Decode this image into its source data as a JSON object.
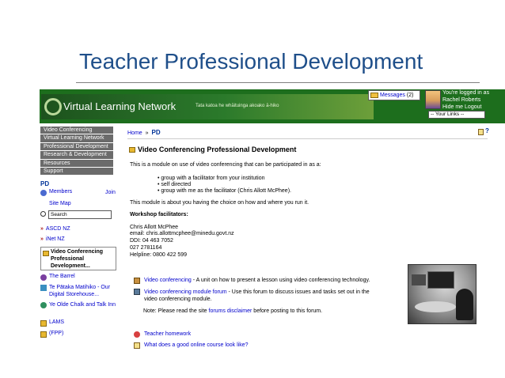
{
  "slide": {
    "title": "Teacher Professional Development"
  },
  "banner": {
    "site_name": "Virtual Learning Network",
    "tagline": "Tata katoa he whāituinga akoako ā-hiko"
  },
  "header": {
    "messages_label": "Messages",
    "messages_count": "(2)",
    "logged_in_text": "You're logged in as",
    "user_name": "Rachel Roberts",
    "hide_me": "Hide me",
    "logout": "Logout",
    "your_links": "-- Your Links --"
  },
  "nav": {
    "items": [
      "Video Conferencing",
      "Virtual Learning Network",
      "Professional Development",
      "Research & Development",
      "Resources",
      "Support"
    ]
  },
  "sidebar": {
    "heading": "PD",
    "members": "Members",
    "join": "Join",
    "site_map": "Site Map",
    "search_value": "Search",
    "links": [
      "ASCD NZ",
      "iNet NZ"
    ],
    "active_item": "Video Conferencing Professional Development...",
    "more_links": [
      "The Barrel",
      "Te Pātaka Matihiko - Our Digital Storehouse...",
      "Ye Olde Chalk and Talk Inn",
      "LAMS",
      "(FPP)"
    ]
  },
  "breadcrumb": {
    "home": "Home",
    "sep": "»",
    "current": "PD"
  },
  "module": {
    "title": "Video Conferencing Professional Development",
    "intro": "This is a module on use of video conferencing that can be participated in as a:",
    "bullets": [
      "group with a facilitator from your institution",
      "self directed",
      "group with me as the facilitator (Chris Allott McPhee)."
    ],
    "choice_text": "This module is about you having the choice on how and where you run it.",
    "facilitators_heading": "Workshop facilitators:",
    "contact": [
      "Chris Allott McPhee",
      "email: chris.allottmcphee@minedu.govt.nz",
      "DDI: 04 463 7052",
      "027 2781164",
      "Helpline: 0800 422 599"
    ]
  },
  "resources": {
    "r1_link": "Video conferencing",
    "r1_text": " - A unit on how to present a lesson using video conferencing technology.",
    "r2_link": "Video conferencing module forum",
    "r2_text_line1": " - Use this forum to discuss issues and tasks set out in the",
    "r2_text_line2": "video conferencing module.",
    "note_prefix": "Note: Please read the site ",
    "note_link": "forums disclaimer",
    "note_suffix": " before posting to this forum.",
    "r3_link": "Teacher homework",
    "r4_link": "What does a good online course look like?"
  },
  "colors": {
    "banner_green": "#1d6e1d",
    "title_blue": "#1f4f8a",
    "nav_gray": "#6b6b6b",
    "link_blue": "#0000cc"
  }
}
